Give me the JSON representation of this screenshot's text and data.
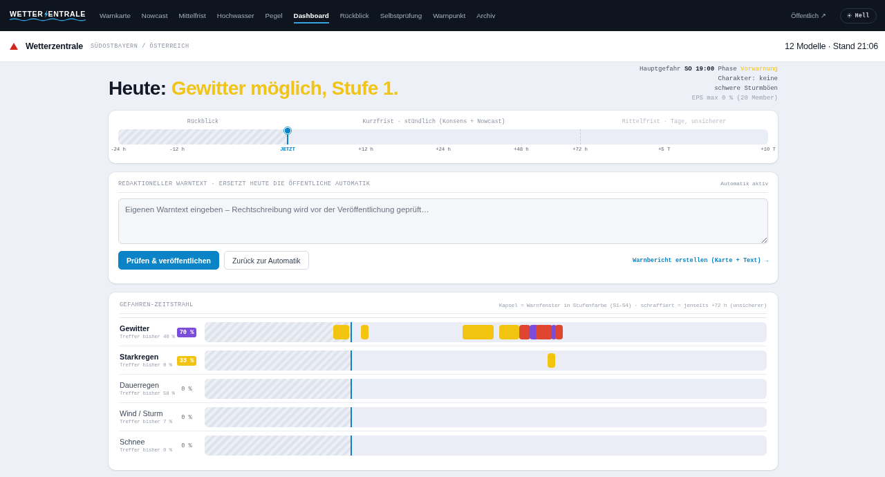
{
  "topbar": {
    "logo": {
      "left": "WETTER",
      "right": "ENTRALE"
    },
    "nav": [
      {
        "label": "Warnkarte",
        "selected": false
      },
      {
        "label": "Nowcast",
        "selected": false
      },
      {
        "label": "Mittelfrist",
        "selected": false
      },
      {
        "label": "Hochwasser",
        "selected": false
      },
      {
        "label": "Pegel",
        "selected": false
      },
      {
        "label": "Dashboard",
        "selected": true
      },
      {
        "label": "Rückblick",
        "selected": false
      },
      {
        "label": "Selbstprüfung",
        "selected": false
      },
      {
        "label": "Warnpunkt",
        "selected": false
      },
      {
        "label": "Archiv",
        "selected": false
      }
    ],
    "public_link": "Öffentlich ↗",
    "theme_button": "Hell"
  },
  "subheader": {
    "app_name": "Wetterzentrale",
    "region": "SÜDOSTBAYERN / ÖSTERREICH",
    "status": "12 Modelle · Stand 21:06"
  },
  "hero": {
    "prefix": "Heute:",
    "headline": "Gewitter möglich, Stufe 1.",
    "main_hazard_label": "Hauptgefahr",
    "main_hazard_time": "SO 19:00",
    "phase_label": "Phase",
    "phase": "Vorwarnung",
    "character": "Charakter: keine schwere Sturmböen",
    "eps": "EPS max 0 % (20 Member)"
  },
  "timeline": {
    "sections": [
      {
        "label": "Rückblick",
        "kind": "past"
      },
      {
        "label": "Kurzfrist · stündlich (Konsens + Nowcast)",
        "kind": "short"
      },
      {
        "label": "Mittelfrist · Tage, unsicherer",
        "kind": "medium"
      }
    ],
    "ticks": [
      {
        "label": "-24 h",
        "now": false
      },
      {
        "label": "-12 h",
        "now": false
      },
      {
        "label": "JETZT",
        "now": true
      },
      {
        "label": "+12 h",
        "now": false
      },
      {
        "label": "+24 h",
        "now": false
      },
      {
        "label": "+48 h",
        "now": false
      },
      {
        "label": "+72 h",
        "now": false
      },
      {
        "label": "+5 T",
        "now": false
      },
      {
        "label": "+10 T",
        "now": false
      }
    ]
  },
  "editor": {
    "title": "REDAKTIONELLER WARNTEXT · ERSETZT HEUTE DIE ÖFFENTLICHE AUTOMATIK",
    "status": "Automatik aktiv",
    "placeholder": "Eigenen Warntext eingeben – Rechtschreibung wird vor der Veröffentlichung geprüft…",
    "buttons": [
      {
        "label": "Prüfen & veröffentlichen",
        "kind": "primary"
      },
      {
        "label": "Zurück zur Automatik",
        "kind": "secondary"
      }
    ],
    "report_link": "Warnbericht erstellen (Karte + Text) →"
  },
  "hazards": {
    "title": "GEFAHREN-ZEITSTRAHL",
    "legend": "Kapsel = Warnfenster in Stufenfarbe (S1–S4) · schraffiert = jenseits +72 h (unsicherer)",
    "rows": [
      {
        "name": "Gewitter",
        "active": true,
        "hits": "Treffer bisher 40 %",
        "probability": "70 %",
        "color": "#7c4dd8",
        "windows": [
          {
            "color": "#f2c40f"
          },
          {
            "color": "#f2c40f"
          },
          {
            "color": "#f2c40f"
          },
          {
            "color": "#f2c40f"
          },
          {
            "color": "#e0462f"
          },
          {
            "color": "#7c4dd8"
          },
          {
            "color": "#e0462f"
          },
          {
            "color": "#7c4dd8"
          },
          {
            "color": "#e0462f"
          }
        ]
      },
      {
        "name": "Starkregen",
        "active": true,
        "hits": "Treffer bisher 0 %",
        "probability": "33 %",
        "color": "#f2c40f",
        "windows": [
          {
            "color": "#f2c40f"
          }
        ]
      },
      {
        "name": "Dauerregen",
        "active": false,
        "hits": "Treffer bisher 58 %",
        "probability": "0 %"
      },
      {
        "name": "Wind / Sturm",
        "active": false,
        "hits": "Treffer bisher 7 %",
        "probability": "0 %"
      },
      {
        "name": "Schnee",
        "active": false,
        "hits": "Treffer bisher 0 %",
        "probability": "0 %"
      }
    ]
  }
}
